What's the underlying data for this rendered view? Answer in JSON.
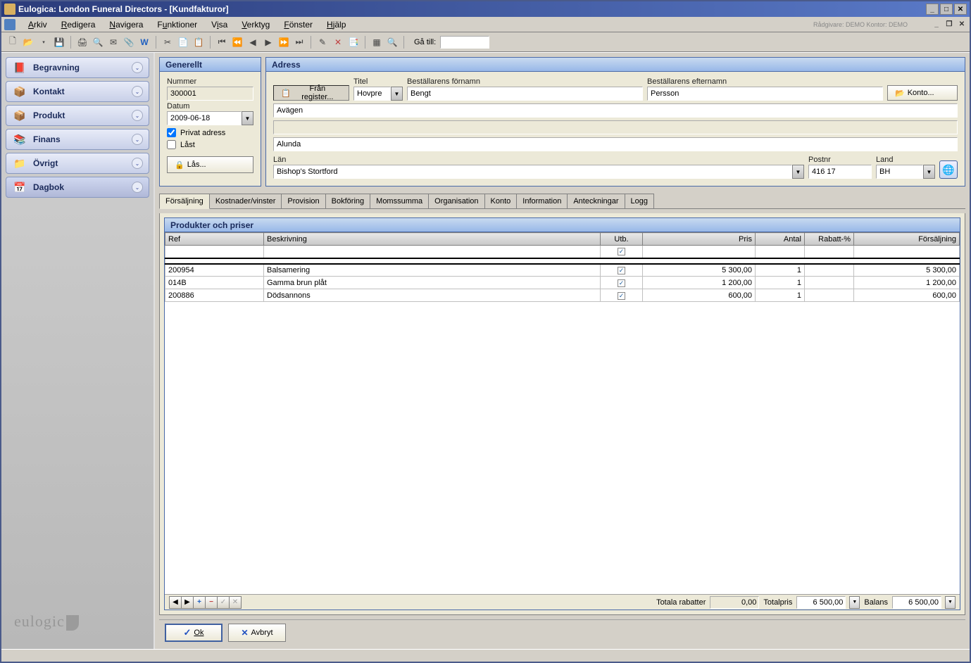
{
  "window": {
    "title": "Eulogica: London Funeral Directors - [Kundfakturor]"
  },
  "menu": {
    "arkiv": "Arkiv",
    "redigera": "Redigera",
    "navigera": "Navigera",
    "funktioner": "Funktioner",
    "visa": "Visa",
    "verktyg": "Verktyg",
    "fonster": "Fönster",
    "hjalp": "Hjälp",
    "info": "Rådgivare: DEMO   Kontor: DEMO"
  },
  "toolbar": {
    "goto_label": "Gå till:",
    "goto_value": ""
  },
  "sidebar": {
    "items": [
      {
        "label": "Begravning",
        "icon": "📕"
      },
      {
        "label": "Kontakt",
        "icon": "📦"
      },
      {
        "label": "Produkt",
        "icon": "📦"
      },
      {
        "label": "Finans",
        "icon": "📚"
      },
      {
        "label": "Övrigt",
        "icon": "📁"
      },
      {
        "label": "Dagbok",
        "icon": "📅"
      }
    ],
    "logo": "eulogic"
  },
  "general": {
    "header": "Generellt",
    "nummer_label": "Nummer",
    "nummer": "300001",
    "datum_label": "Datum",
    "datum": "2009-06-18",
    "privat_label": "Privat adress",
    "privat_checked": true,
    "last_label": "Låst",
    "last_checked": false,
    "las_btn": "Lås..."
  },
  "address": {
    "header": "Adress",
    "from_register": "Från register...",
    "titel_label": "Titel",
    "titel": "Hovpre",
    "fornamn_label": "Beställarens förnamn",
    "fornamn": "Bengt",
    "efternamn_label": "Beställarens efternamn",
    "efternamn": "Persson",
    "konto_btn": "Konto...",
    "line1": "Avägen",
    "line2": "",
    "line3": "Alunda",
    "lan_label": "Län",
    "lan": "Bishop's Stortford",
    "postnr_label": "Postnr",
    "postnr": "416 17",
    "land_label": "Land",
    "land": "BH"
  },
  "tabs": [
    "Försäljning",
    "Kostnader/vinster",
    "Provision",
    "Bokföring",
    "Momssumma",
    "Organisation",
    "Konto",
    "Information",
    "Anteckningar",
    "Logg"
  ],
  "products": {
    "header": "Produkter och priser",
    "cols": {
      "ref": "Ref",
      "beskrivning": "Beskrivning",
      "utb": "Utb.",
      "pris": "Pris",
      "antal": "Antal",
      "rabatt": "Rabatt-%",
      "forsaljning": "Försäljning"
    },
    "rows": [
      {
        "ref": "200954",
        "beskrivning": "Balsamering",
        "utb": true,
        "pris": "5 300,00",
        "antal": "1",
        "rabatt": "",
        "forsaljning": "5 300,00"
      },
      {
        "ref": "014B",
        "beskrivning": "Gamma brun plåt",
        "utb": true,
        "pris": "1 200,00",
        "antal": "1",
        "rabatt": "",
        "forsaljning": "1 200,00"
      },
      {
        "ref": "200886",
        "beskrivning": "Dödsannons",
        "utb": true,
        "pris": "600,00",
        "antal": "1",
        "rabatt": "",
        "forsaljning": "600,00"
      }
    ]
  },
  "totals": {
    "rabatter_label": "Totala rabatter",
    "rabatter": "0,00",
    "totalpris_label": "Totalpris",
    "totalpris": "6 500,00",
    "balans_label": "Balans",
    "balans": "6 500,00"
  },
  "buttons": {
    "ok": "Ok",
    "avbryt": "Avbryt"
  }
}
